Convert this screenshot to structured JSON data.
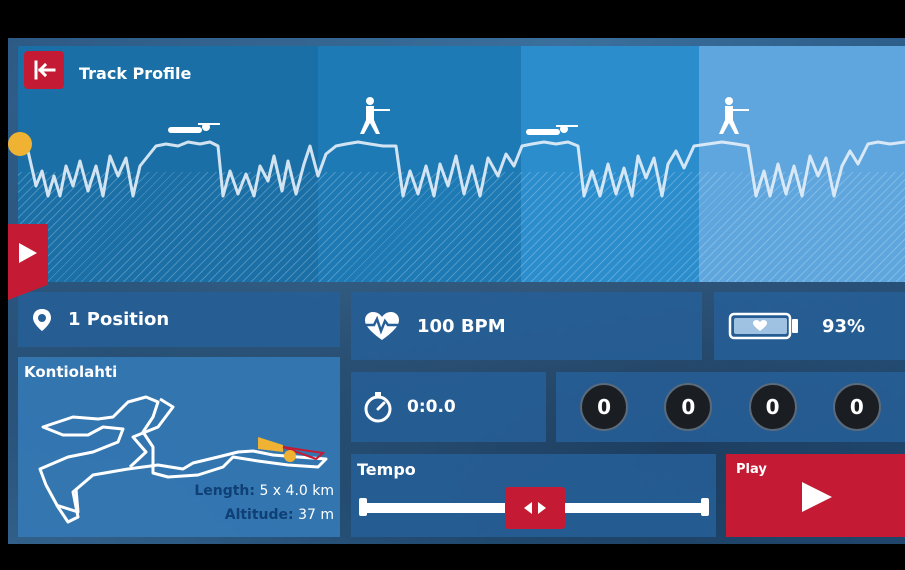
{
  "header": {
    "title": "Track Profile"
  },
  "position": {
    "label": "1 Position"
  },
  "heart_rate": {
    "label": "100 BPM"
  },
  "battery": {
    "label": "93%"
  },
  "track": {
    "name": "Kontiolahti",
    "length_key": "Length:",
    "length_value": "5 x 4.0 km",
    "altitude_key": "Altitude:",
    "altitude_value": "37 m"
  },
  "timer": {
    "label": "0:0.0"
  },
  "shots": {
    "values": [
      "0",
      "0",
      "0",
      "0"
    ]
  },
  "tempo": {
    "label": "Tempo"
  },
  "play": {
    "label": "Play"
  },
  "colors": {
    "accent": "#c41a33",
    "marker": "#f0b232",
    "panel": "#255f96"
  },
  "icons": [
    "back-arrow-icon",
    "play-icon",
    "location-pin-icon",
    "heart-rate-icon",
    "battery-icon",
    "stopwatch-icon",
    "prone-shooter-icon",
    "standing-shooter-icon",
    "left-right-arrows-icon"
  ]
}
